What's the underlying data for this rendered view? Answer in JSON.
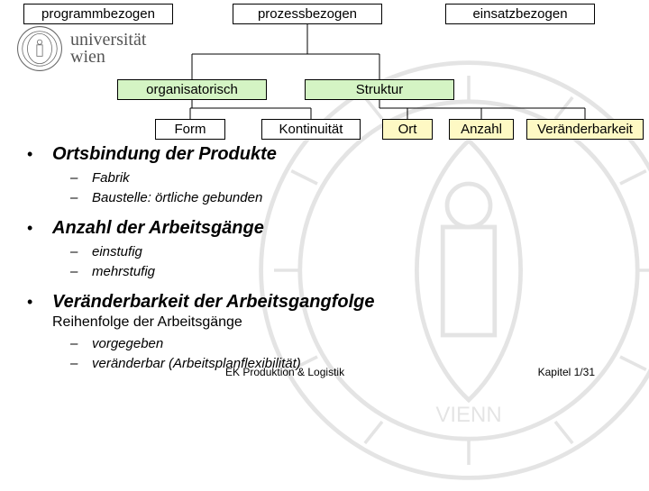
{
  "hierarchy": {
    "top": [
      "programmbezogen",
      "prozessbezogen",
      "einsatzbezogen"
    ],
    "mid": [
      "organisatorisch",
      "Struktur"
    ],
    "leaves": [
      "Form",
      "Kontinuität",
      "Ort",
      "Anzahl",
      "Veränderbarkeit"
    ]
  },
  "logo": {
    "line1": "universität",
    "line2": "wien"
  },
  "bullets": [
    {
      "title": "Ortsbindung der Produkte",
      "subs": [
        "Fabrik",
        "Baustelle: örtliche gebunden"
      ]
    },
    {
      "title": "Anzahl der Arbeitsgänge",
      "subs": [
        "einstufig",
        "mehrstufig"
      ]
    },
    {
      "title": "Veränderbarkeit der Arbeitsgangfolge",
      "extra": "Reihenfolge der Arbeitsgänge",
      "subs": [
        "vorgegeben",
        "veränderbar (Arbeitsplanflexibilität)"
      ]
    }
  ],
  "footer": {
    "left": "EK Produktion & Logistik",
    "right": "Kapitel 1/31"
  }
}
